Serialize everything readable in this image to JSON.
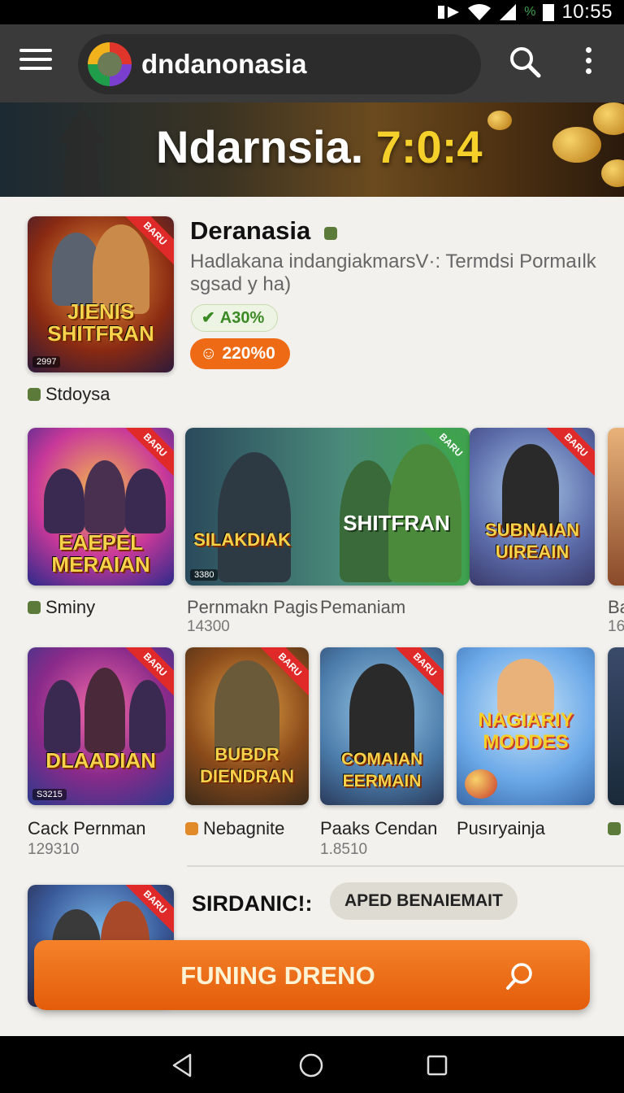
{
  "status_bar": {
    "time": "10:55",
    "battery_icon": "battery-icon",
    "wifi_icon": "wifi-icon",
    "signal_icon": "signal-icon"
  },
  "app_bar": {
    "brand": "dndanonasia"
  },
  "hero": {
    "title_main": "Ndarnsia.",
    "title_highlight": "7:0:4"
  },
  "featured": {
    "thumb_title": "JIENIS SHITFRAN",
    "thumb_ribbon": "BARU",
    "thumb_corner": "2997",
    "title": "Deranasia",
    "description": "Hadlakana indangiakmarsV·: Termdsi Pormaılk sgsad  y ha)",
    "chip_green": "A30%",
    "chip_orange": "220%0",
    "studio": "Stdoysa"
  },
  "row1": [
    {
      "thumb_title": "EAEPEL MERAIAN",
      "ribbon": "BARU",
      "label": "Sminy",
      "sub": ""
    },
    {
      "thumb_title": "SILAKDIAK",
      "ribbon": "",
      "corner": "3380",
      "label": "Pernmakn Pagis",
      "sub": "14300"
    },
    {
      "thumb_title": "SHITFRAN",
      "ribbon": "BARU",
      "label": "Pemaniam",
      "sub": ""
    },
    {
      "thumb_title": "SUBNAIAN UIREAIN",
      "ribbon": "BARU",
      "label": "",
      "sub": ""
    },
    {
      "thumb_title": "",
      "ribbon": "",
      "label": "Ba",
      "sub": "16"
    }
  ],
  "row2": [
    {
      "thumb_title": "DLAADIAN",
      "ribbon": "BARU",
      "corner": "S3215",
      "label": "Cack Pernman",
      "sub": "129310"
    },
    {
      "thumb_title": "BUBDR DIENDRAN",
      "ribbon": "BARU",
      "label": "Nebagnite",
      "sub": ""
    },
    {
      "thumb_title": "COMAIAN EERMAIN",
      "ribbon": "BARU",
      "label": "Paaks Cendan",
      "sub": "1.8510"
    },
    {
      "thumb_title": "NAGIARIY MODDES",
      "ribbon": "",
      "label": "Pusıryainja",
      "sub": ""
    },
    {
      "thumb_title": "",
      "ribbon": "",
      "label": "",
      "sub": ""
    }
  ],
  "section": {
    "title": "SIRDANIC!:",
    "chip": "APED BENAIEMAIT",
    "thumb_ribbon": "BARU"
  },
  "cta": {
    "label": "FUNING DRENO"
  },
  "colors": {
    "accent": "#ef6a14",
    "app_bar": "#3a3a3a",
    "ribbon": "#e02a2a"
  }
}
